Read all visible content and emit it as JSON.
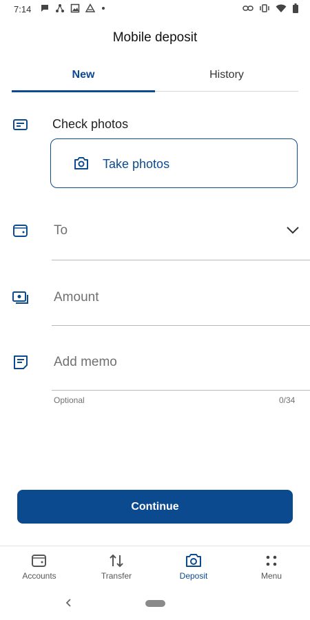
{
  "status_bar": {
    "time": "7:14",
    "left_icons": [
      "chat-icon",
      "network-icon",
      "gallery-icon",
      "drive-icon",
      "dot-icon"
    ],
    "right_icons": [
      "link-icon",
      "vibrate-icon",
      "wifi-icon",
      "battery-icon"
    ]
  },
  "header": {
    "title": "Mobile deposit"
  },
  "tabs": {
    "new": "New",
    "history": "History",
    "active": "New"
  },
  "check_photos": {
    "label": "Check photos",
    "button_label": "Take photos"
  },
  "to_field": {
    "label": "To"
  },
  "amount_field": {
    "label": "Amount"
  },
  "memo_field": {
    "label": "Add memo",
    "helper": "Optional",
    "counter": "0/34"
  },
  "continue_button": {
    "label": "Continue"
  },
  "bottom_nav": {
    "items": [
      {
        "label": "Accounts",
        "icon": "wallet-icon"
      },
      {
        "label": "Transfer",
        "icon": "transfer-icon"
      },
      {
        "label": "Deposit",
        "icon": "camera-icon"
      },
      {
        "label": "Menu",
        "icon": "menu-dots-icon"
      }
    ],
    "active": "Deposit"
  },
  "colors": {
    "brand": "#0b4a8f",
    "text": "#1f1f1f",
    "muted": "#707070"
  }
}
